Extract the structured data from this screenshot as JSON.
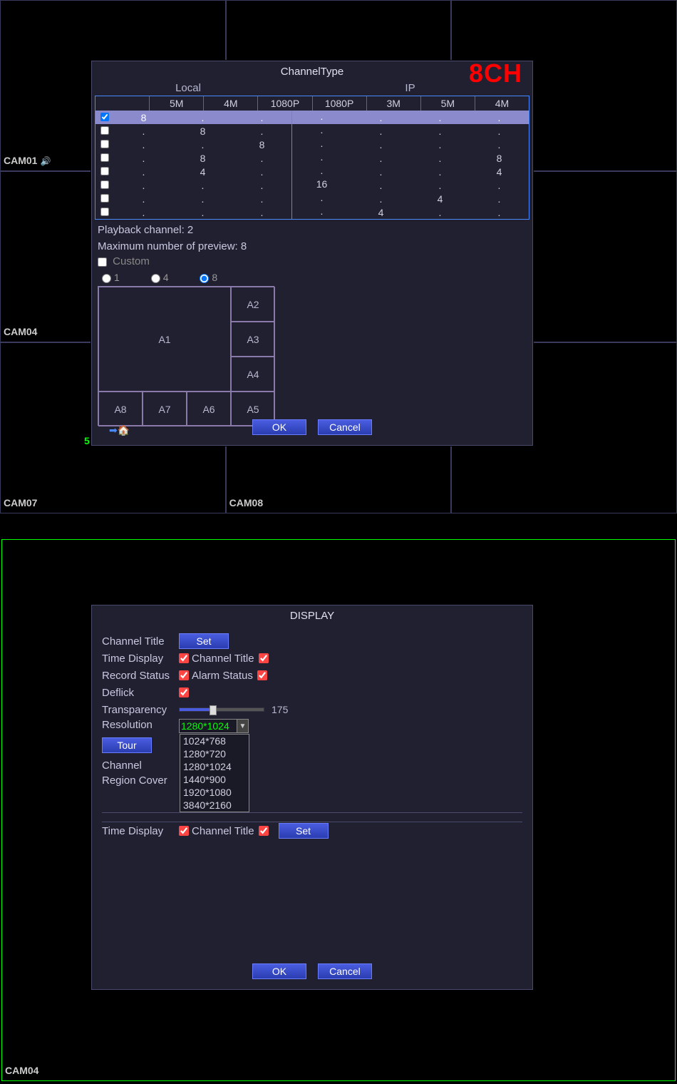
{
  "top_cams": {
    "cam01": "CAM01",
    "cam04": "CAM04",
    "cam07": "CAM07",
    "cam08": "CAM08",
    "green5": "5"
  },
  "bottom_cam": "CAM04",
  "channeltype": {
    "title": "ChannelType",
    "badge": "8CH",
    "group_local": "Local",
    "group_ip": "IP",
    "columns": [
      "5M",
      "4M",
      "1080P",
      "1080P",
      "3M",
      "5M",
      "4M"
    ],
    "rows": [
      {
        "checked": true,
        "vals": [
          "8",
          ".",
          ".",
          ".",
          ".",
          ".",
          "."
        ]
      },
      {
        "checked": false,
        "vals": [
          ".",
          "8",
          ".",
          ".",
          ".",
          ".",
          "."
        ]
      },
      {
        "checked": false,
        "vals": [
          ".",
          ".",
          "8",
          ".",
          ".",
          ".",
          "."
        ]
      },
      {
        "checked": false,
        "vals": [
          ".",
          "8",
          ".",
          ".",
          ".",
          ".",
          "8"
        ]
      },
      {
        "checked": false,
        "vals": [
          ".",
          "4",
          ".",
          ".",
          ".",
          ".",
          "4"
        ]
      },
      {
        "checked": false,
        "vals": [
          ".",
          ".",
          ".",
          "16",
          ".",
          ".",
          "."
        ]
      },
      {
        "checked": false,
        "vals": [
          ".",
          ".",
          ".",
          ".",
          ".",
          "4",
          "."
        ]
      },
      {
        "checked": false,
        "vals": [
          ".",
          ".",
          ".",
          ".",
          "4",
          ".",
          "."
        ]
      }
    ],
    "playback": "Playback channel: 2",
    "maxpreview": "Maximum number of preview: 8",
    "custom_label": "Custom",
    "radios": {
      "r1": "1",
      "r4": "4",
      "r8": "8"
    },
    "layout_cells": [
      "A1",
      "A2",
      "A3",
      "A4",
      "A5",
      "A6",
      "A7",
      "A8"
    ],
    "ok": "OK",
    "cancel": "Cancel"
  },
  "display": {
    "title": "DISPLAY",
    "channel_title_label": "Channel Title",
    "set_btn": "Set",
    "time_display_label": "Time Display",
    "channel_title_chk": "Channel Title",
    "record_status_label": "Record Status",
    "alarm_status_label": "Alarm Status",
    "deflick_label": "Deflick",
    "transparency_label": "Transparency",
    "transparency_value": "175",
    "resolution_label": "Resolution",
    "resolution_value": "1280*1024",
    "resolution_options": [
      "1024*768",
      "1280*720",
      "1280*1024",
      "1440*900",
      "1920*1080",
      "3840*2160"
    ],
    "tour_btn": "Tour",
    "channel_section": "Channel",
    "region_cover_label": "Region Cover",
    "time_display2_label": "Time Display",
    "channel_title2_chk": "Channel Title",
    "set_btn2": "Set",
    "ok": "OK",
    "cancel": "Cancel"
  }
}
